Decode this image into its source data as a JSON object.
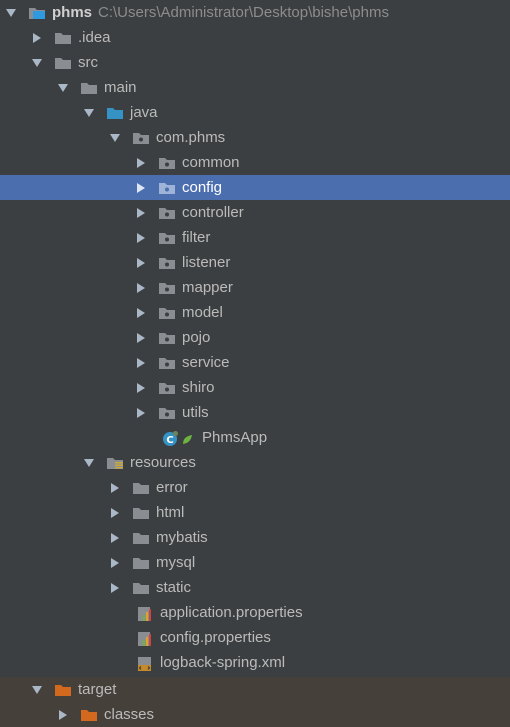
{
  "project_tree": {
    "root": {
      "name": "phms",
      "path": "C:\\Users\\Administrator\\Desktop\\bishe\\phms"
    },
    "items": [
      {
        "label": ".idea",
        "icon": "folder-icon"
      },
      {
        "label": "src",
        "icon": "folder-icon"
      },
      {
        "label": "main",
        "icon": "folder-icon"
      },
      {
        "label": "java",
        "icon": "source-folder-icon"
      },
      {
        "label": "com.phms",
        "icon": "package-icon"
      },
      {
        "label": "common",
        "icon": "package-icon"
      },
      {
        "label": "config",
        "icon": "package-icon",
        "selected": true
      },
      {
        "label": "controller",
        "icon": "package-icon"
      },
      {
        "label": "filter",
        "icon": "package-icon"
      },
      {
        "label": "listener",
        "icon": "package-icon"
      },
      {
        "label": "mapper",
        "icon": "package-icon"
      },
      {
        "label": "model",
        "icon": "package-icon"
      },
      {
        "label": "pojo",
        "icon": "package-icon"
      },
      {
        "label": "service",
        "icon": "package-icon"
      },
      {
        "label": "shiro",
        "icon": "package-icon"
      },
      {
        "label": "utils",
        "icon": "package-icon"
      },
      {
        "label": "PhmsApp",
        "icon": "spring-boot-app-icon"
      },
      {
        "label": "resources",
        "icon": "resources-folder-icon"
      },
      {
        "label": "error",
        "icon": "folder-icon"
      },
      {
        "label": "html",
        "icon": "folder-icon"
      },
      {
        "label": "mybatis",
        "icon": "folder-icon"
      },
      {
        "label": "mysql",
        "icon": "folder-icon"
      },
      {
        "label": "static",
        "icon": "folder-icon"
      },
      {
        "label": "application.properties",
        "icon": "properties-file-icon"
      },
      {
        "label": "config.properties",
        "icon": "properties-file-icon"
      },
      {
        "label": "logback-spring.xml",
        "icon": "xml-file-icon"
      },
      {
        "label": "target",
        "icon": "excluded-folder-icon"
      },
      {
        "label": "classes",
        "icon": "excluded-folder-icon"
      }
    ]
  },
  "colors": {
    "background": "#3c3f41",
    "selection": "#4b6eaf",
    "excluded_background": "#45403a",
    "text": "#bbbbbb"
  }
}
